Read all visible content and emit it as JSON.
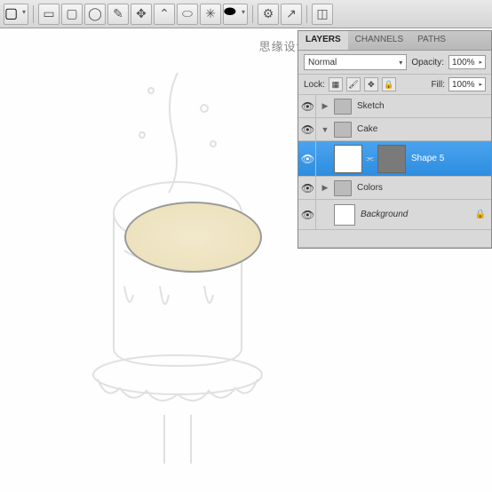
{
  "toolbar": {
    "icons": [
      "rect",
      "rrect",
      "ellipse",
      "pen",
      "anchor",
      "convert",
      "path",
      "shape",
      "oval",
      "blob",
      "gear",
      "arrow"
    ]
  },
  "watermark": "思缘设计论坛 · MISSYUAN.COM",
  "panel": {
    "tabs": {
      "layers": "LAYERS",
      "channels": "CHANNELS",
      "paths": "PATHS"
    },
    "blend_mode": "Normal",
    "opacity_label": "Opacity:",
    "opacity_value": "100%",
    "lock_label": "Lock:",
    "fill_label": "Fill:",
    "fill_value": "100%"
  },
  "layers": {
    "sketch": "Sketch",
    "cake": "Cake",
    "shape5": "Shape 5",
    "colors": "Colors",
    "background": "Background"
  }
}
